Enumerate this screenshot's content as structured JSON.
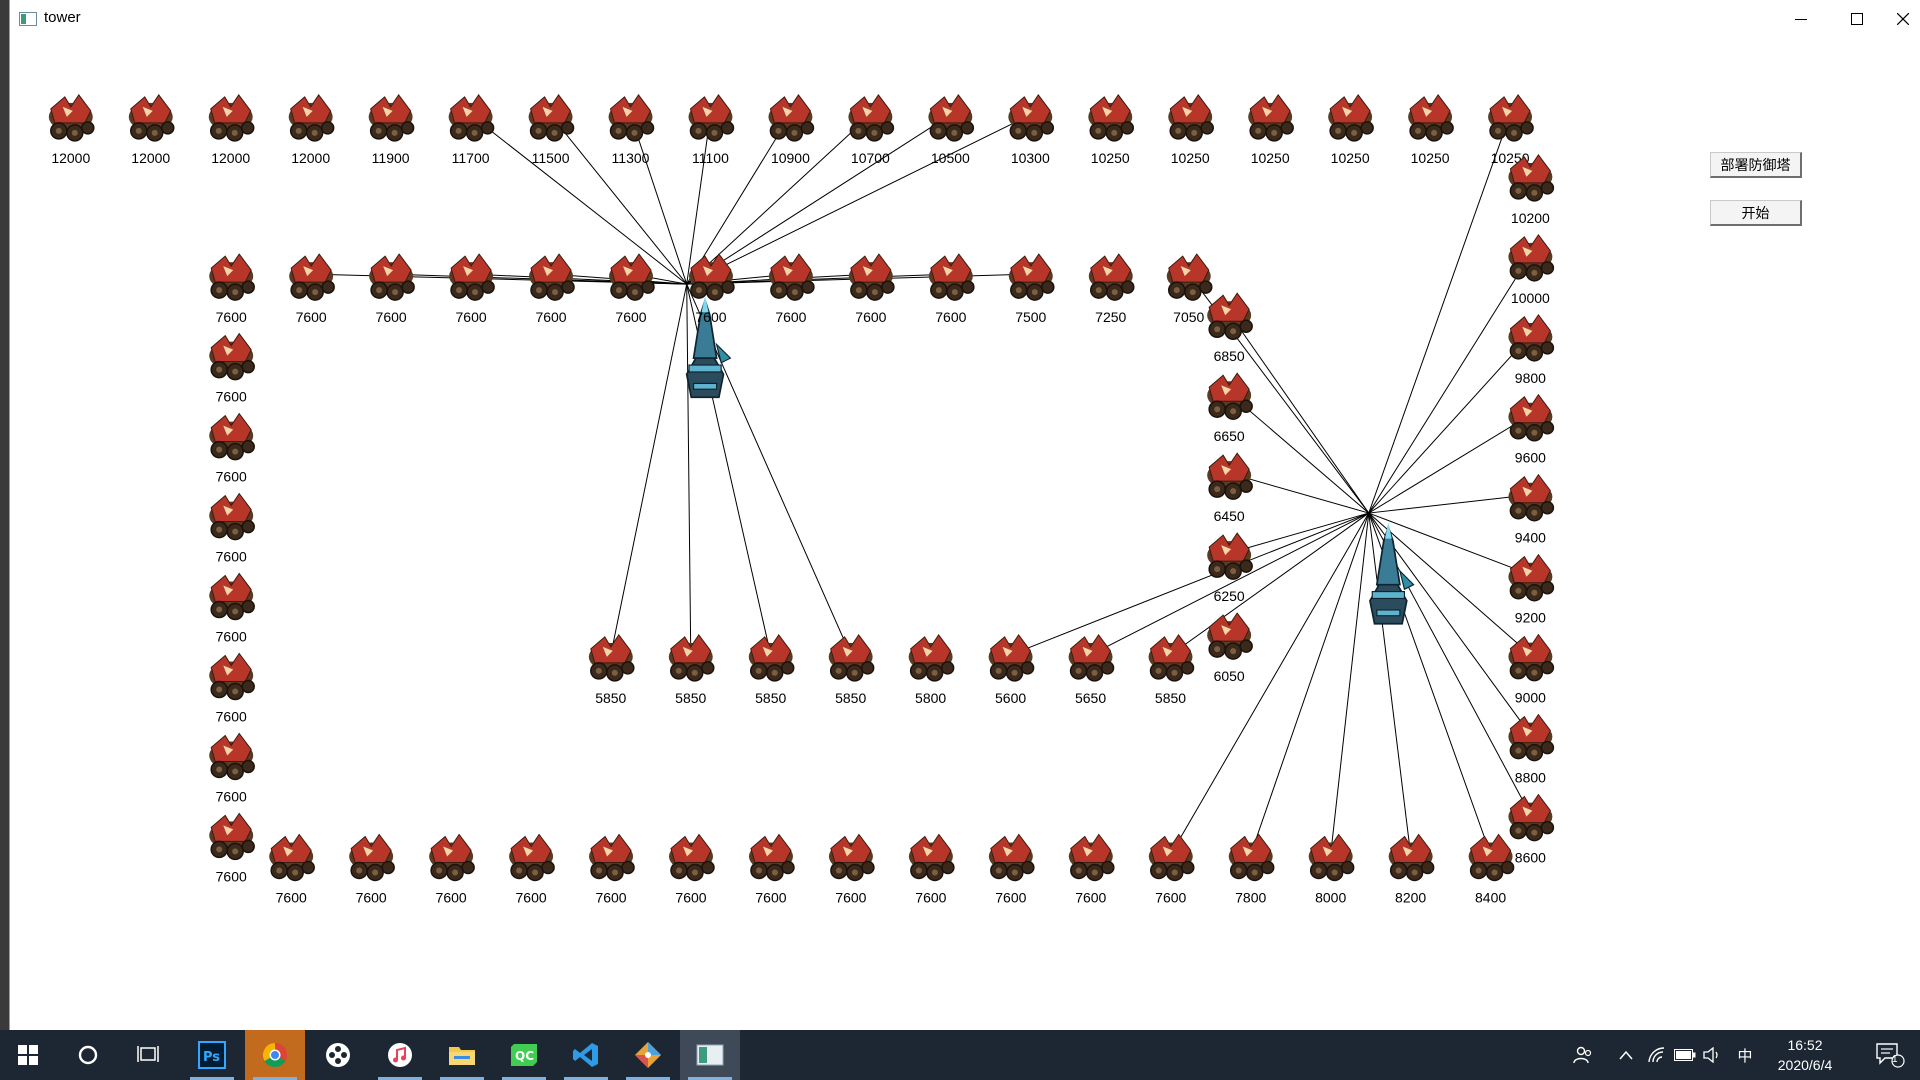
{
  "window": {
    "title": "tower"
  },
  "buttons": {
    "deploy": "部署防御塔",
    "start": "开始"
  },
  "colors": {
    "taskbar": "#1c2733",
    "accent": "#7fb0de",
    "monster": "#b8352a",
    "tower": "#2f8fa8"
  },
  "monsters": {
    "top_row": [
      "12000",
      "12000",
      "12000",
      "12000",
      "11900",
      "11700",
      "11500",
      "11300",
      "11100",
      "10900",
      "10700",
      "10500",
      "10300",
      "10250",
      "10250",
      "10250",
      "10250",
      "10250",
      "10250"
    ],
    "second_row": [
      "7600",
      "7600",
      "7600",
      "7600",
      "7600",
      "7600",
      "7600",
      "7600",
      "7600",
      "7600",
      "7500",
      "7250",
      "7050"
    ],
    "left_column": [
      "7600",
      "7600",
      "7600",
      "7600",
      "7600",
      "7600",
      "7600"
    ],
    "middle_row": [
      "5850",
      "5850",
      "5850",
      "5850",
      "5800",
      "5600",
      "5650",
      "5850"
    ],
    "inner_column": [
      "6850",
      "6650",
      "6450",
      "6250",
      "6050"
    ],
    "right_column": [
      "10200",
      "10000",
      "9800",
      "9600",
      "9400",
      "9200",
      "9000",
      "8800",
      "8600"
    ],
    "bottom_row": [
      "7600",
      "7600",
      "7600",
      "7600",
      "7600",
      "7600",
      "7600",
      "7600",
      "7600",
      "7600",
      "7600",
      "7600",
      "7800",
      "8000",
      "8200",
      "8400"
    ]
  },
  "taskbar": {
    "apps": [
      {
        "name": "photoshop",
        "icon": "photoshop-icon"
      },
      {
        "name": "chrome",
        "icon": "chrome-icon"
      },
      {
        "name": "media-player",
        "icon": "media-player-icon"
      },
      {
        "name": "itunes",
        "icon": "itunes-icon"
      },
      {
        "name": "file-explorer",
        "icon": "folder-icon"
      },
      {
        "name": "qt-creator",
        "icon": "qt-icon"
      },
      {
        "name": "vscode",
        "icon": "vscode-icon"
      },
      {
        "name": "git-tool",
        "icon": "git-icon"
      },
      {
        "name": "tower-app",
        "icon": "window-icon"
      }
    ],
    "ime": "中",
    "time": "16:52",
    "date": "2020/6/4",
    "notification_count": "1"
  }
}
